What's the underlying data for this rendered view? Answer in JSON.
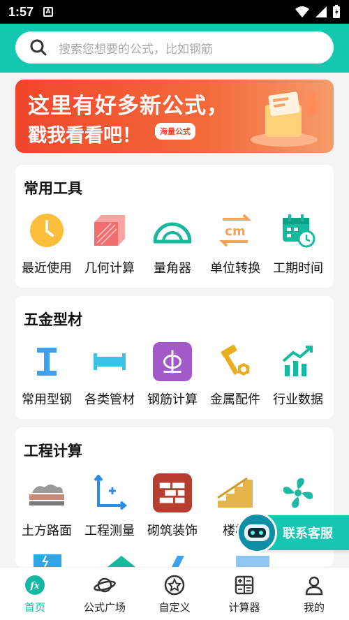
{
  "status": {
    "time": "1:57",
    "notif_letter": "A"
  },
  "search": {
    "placeholder": "搜索您想要的公式，比如钢筋"
  },
  "banner": {
    "line1": "这里有好多新公式，",
    "line2": "戳我看看吧！",
    "tag": "海量公式"
  },
  "sections": [
    {
      "title": "常用工具",
      "items": [
        {
          "label": "最近使用",
          "icon": "clock-icon"
        },
        {
          "label": "几何计算",
          "icon": "cube-icon"
        },
        {
          "label": "量角器",
          "icon": "protractor-icon"
        },
        {
          "label": "单位转换",
          "icon": "unit-convert-icon"
        },
        {
          "label": "工期时间",
          "icon": "calendar-clock-icon"
        }
      ]
    },
    {
      "title": "五金型材",
      "items": [
        {
          "label": "常用型钢",
          "icon": "i-beam-icon"
        },
        {
          "label": "各类管材",
          "icon": "pipe-icon"
        },
        {
          "label": "钢筋计算",
          "icon": "rebar-icon"
        },
        {
          "label": "金属配件",
          "icon": "hammer-nut-icon"
        },
        {
          "label": "行业数据",
          "icon": "trend-chart-icon"
        }
      ]
    },
    {
      "title": "工程计算",
      "items": [
        {
          "label": "土方路面",
          "icon": "earthwork-icon"
        },
        {
          "label": "工程测量",
          "icon": "axis-measure-icon"
        },
        {
          "label": "砌筑装饰",
          "icon": "brick-wall-icon"
        },
        {
          "label": "楼梯",
          "icon": "stairs-icon"
        },
        {
          "label": "",
          "icon": "fan-icon"
        }
      ]
    }
  ],
  "float_button": {
    "label": "联系客服"
  },
  "tabbar": [
    {
      "label": "首页",
      "icon": "fx-icon",
      "active": true
    },
    {
      "label": "公式广场",
      "icon": "planet-icon",
      "active": false
    },
    {
      "label": "自定义",
      "icon": "star-badge-icon",
      "active": false
    },
    {
      "label": "计算器",
      "icon": "calculator-icon",
      "active": false
    },
    {
      "label": "我的",
      "icon": "user-icon",
      "active": false
    }
  ],
  "colors": {
    "accent": "#14c7b0",
    "banner": "#f0462c"
  }
}
